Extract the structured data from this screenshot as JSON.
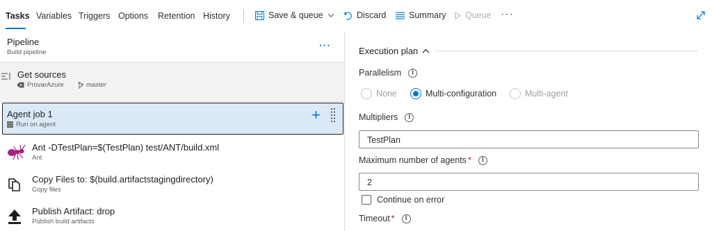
{
  "tabs": [
    {
      "label": "Tasks"
    },
    {
      "label": "Variables"
    },
    {
      "label": "Triggers"
    },
    {
      "label": "Options"
    },
    {
      "label": "Retention"
    },
    {
      "label": "History"
    }
  ],
  "toolbar": {
    "save_queue_label": "Save & queue",
    "discard_label": "Discard",
    "summary_label": "Summary",
    "queue_label": "Queue"
  },
  "pipeline": {
    "title": "Pipeline",
    "subtitle": "Build pipeline"
  },
  "get_sources": {
    "title": "Get sources",
    "repo": "ProvarAzure",
    "branch": "master"
  },
  "agent_job": {
    "title": "Agent job 1",
    "subtitle": "Run on agent"
  },
  "tasks": [
    {
      "title": "Ant -DTestPlan=$(TestPlan) test/ANT/build.xml",
      "subtitle": "Ant",
      "icon": "ant-icon"
    },
    {
      "title": "Copy Files to: $(build.artifactstagingdirectory)",
      "subtitle": "Copy files",
      "icon": "copy-files-icon"
    },
    {
      "title": "Publish Artifact: drop",
      "subtitle": "Publish build artifacts",
      "icon": "publish-artifact-icon"
    }
  ],
  "execution_plan": {
    "title": "Execution plan",
    "parallelism_label": "Parallelism",
    "options": [
      {
        "label": "None",
        "selected": false,
        "enabled": true
      },
      {
        "label": "Multi-configuration",
        "selected": true,
        "enabled": true
      },
      {
        "label": "Multi-agent",
        "selected": false,
        "enabled": true
      }
    ],
    "multipliers_label": "Multipliers",
    "multipliers_value": "TestPlan",
    "max_agents_label": "Maximum number of agents",
    "max_agents_value": "2",
    "continue_on_error_label": "Continue on error",
    "continue_on_error_checked": false,
    "timeout_label": "Timeout",
    "required_marker": "*"
  },
  "colors": {
    "accent": "#0078d4",
    "selected_row": "#dbe9f7",
    "ant_icon": "#a8207e"
  }
}
